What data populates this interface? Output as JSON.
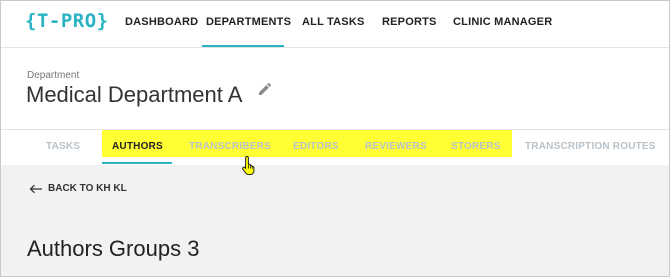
{
  "logo": "{T-PRO}",
  "nav": {
    "items": [
      {
        "label": "DASHBOARD"
      },
      {
        "label": "DEPARTMENTS"
      },
      {
        "label": "ALL TASKS"
      },
      {
        "label": "REPORTS"
      },
      {
        "label": "CLINIC MANAGER"
      }
    ],
    "active": "DEPARTMENTS"
  },
  "department": {
    "label": "Department",
    "name": "Medical Department A",
    "edit_icon": "pencil-icon"
  },
  "tabs": {
    "items": [
      {
        "label": "TASKS"
      },
      {
        "label": "AUTHORS"
      },
      {
        "label": "TRANSCRIBERS"
      },
      {
        "label": "EDITORS"
      },
      {
        "label": "REVIEWERS"
      },
      {
        "label": "STORERS"
      },
      {
        "label": "TRANSCRIPTION ROUTES"
      }
    ],
    "active": "AUTHORS"
  },
  "content": {
    "back_label": "BACK TO KH KL",
    "title": "Authors Groups 3"
  },
  "colors": {
    "accent": "#2ab3c3",
    "highlight": "#ffff33",
    "inactive_tab": "#b8c2c8",
    "content_bg": "#f2f2f2"
  }
}
